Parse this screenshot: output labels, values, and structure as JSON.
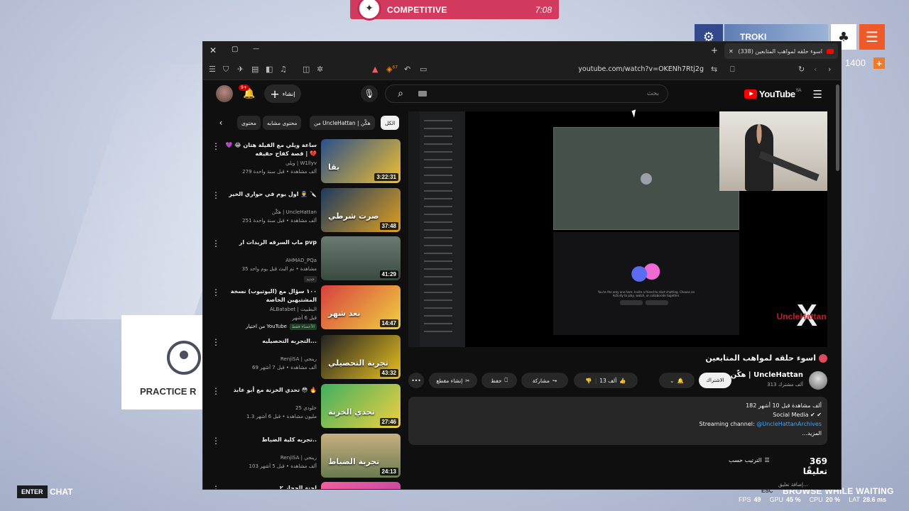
{
  "game": {
    "mode_label": "COMPETITIVE",
    "timer": "7:08",
    "player_tag": "TROKI",
    "points": "1400",
    "plus": "+",
    "practice_label": "PRACTICE R",
    "enter_key": "ENTER",
    "chat_label": "CHAT",
    "esc_key": "ESC",
    "browse_label": "BROWSE WHILE WAITING",
    "stats": {
      "fps_label": "FPS",
      "fps": "49",
      "gpu_label": "GPU",
      "gpu": "45 %",
      "cpu_label": "CPU",
      "cpu": "20 %",
      "lat_label": "LAT",
      "lat": "28.6 ms"
    }
  },
  "browser": {
    "tab_title": "(338) اسوء حلقه لمواهب المتابعين",
    "url": "youtube.com/watch?v=OKENh7Rtj2g",
    "ext_badge": "67",
    "close": "✕",
    "minimize": "—",
    "maximize": "▢",
    "new_tab": "+"
  },
  "youtube": {
    "logo_text": "YouTube",
    "region": "SA",
    "search_placeholder": "بحث",
    "create_label": "إنشاء",
    "notif_count": "9+",
    "video": {
      "title": "اسوء حلقه لمواهب المتابعين",
      "channel": "هكّن | UncleHattan",
      "subs": "313 ألف مشترك",
      "subscribe": "الاشتراك",
      "likes": "13 ألف",
      "share": "مشاركة",
      "save": "حفظ",
      "clip": "إنشاء مقطع",
      "more": "•••",
      "overlay_brand": "UncleHattan",
      "overlay_x": "X",
      "discord_empty": "You're the only one here. Invite a friend to start chatting. Choose an Activity to play, watch, or collaborate together."
    },
    "description": {
      "stats": "182 ألف مشاهدة  قبل 10 أشهر",
      "line1": "Social Media ✔ ✔",
      "line2_prefix": "Streaming channel: ",
      "line2_link": "@UncleHattanArchives",
      "more": "...المزيد"
    },
    "comments": {
      "count": "369 تعليقًا",
      "sort": "الترتيب حسب",
      "add": "إضافة تعليق..."
    },
    "chips": [
      "الكل",
      "من UncleHattan | هكّن",
      "محتوى مشابه",
      "محتوى"
    ],
    "recommendations": [
      {
        "title": "ساعة ويلي مع الفيلة هتان 😂 💜 | قصة كفاح حقيقه 💔",
        "channel": "ويلي | W1llyv",
        "meta": "279 ألف مشاهدة • قبل سنة واحدة",
        "duration": "3:22:31",
        "thumb_text": "يقا"
      },
      {
        "title": "اول يوم في حواري الخير 👮‍♂️ 🔪",
        "channel": "هكّن | UncleHattan",
        "meta": "251 ألف مشاهدة • قبل سنة واحدة",
        "duration": "37:48",
        "thumb_text": "صرت شرطي"
      },
      {
        "title": "ماب السرقه الريدات ار pvp",
        "channel": "AHMAD_PQa",
        "meta": "35 مشاهدة • تم البث قبل يوم واحد",
        "duration": "41:29",
        "badge": "جديد",
        "thumb_text": ""
      },
      {
        "title": "١٠٠ سؤال مع (اليوتيوب) نسخة المشتبهين الخاصة",
        "channel": "ALBatabet | البطبيت",
        "meta": "قبل 6 أشهر",
        "duration": "14:47",
        "members": "الأعضاء فقط",
        "extra": "من اختيار YouTube",
        "thumb_text": "بعد شهر"
      },
      {
        "title": "التجربه التحصيليه...",
        "channel": "RenjiSA | رينجي",
        "meta": "69 ألف مشاهدة • قبل 7 أشهر",
        "duration": "43:32",
        "thumb_text": "تجربة التحصيلي"
      },
      {
        "title": "تحدي الخزنة مع أبو عابد 😳 🔥",
        "channel": "خلودي 25",
        "meta": "1.3 مليون مشاهدة • قبل 6 أشهر",
        "duration": "27:46",
        "thumb_text": "تحدي الخزنة"
      },
      {
        "title": "تجربه كلية الضباط..",
        "channel": "RenjiSA | رينجي",
        "meta": "103 ألف مشاهدة • قبل 5 أشهر",
        "duration": "24:13",
        "thumb_text": "تجربة الضباط"
      },
      {
        "title": "لجنة الحجاز ٢",
        "channel": "",
        "meta": "",
        "duration": "",
        "thumb_text": ""
      }
    ]
  },
  "colors": {
    "accent": "#d33a5f",
    "yt_red": "#ff0000",
    "link": "#3ea6ff",
    "bg_dark": "#0f0f0f"
  }
}
